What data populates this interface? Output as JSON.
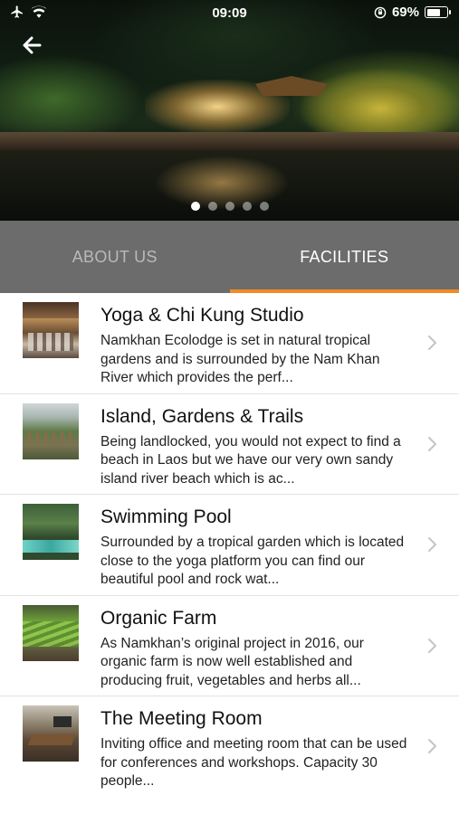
{
  "status_bar": {
    "time": "09:09",
    "battery_percent": "69%",
    "battery_level": 0.69,
    "icons": [
      "airplane-icon",
      "wifi-icon",
      "orientation-lock-icon",
      "battery-icon"
    ]
  },
  "hero": {
    "carousel_pages": 5,
    "active_page": 1
  },
  "tabs": [
    {
      "label": "ABOUT US",
      "active": false
    },
    {
      "label": "FACILITIES",
      "active": true
    }
  ],
  "accent_color": "#f08a24",
  "tab_bar_color": "#6c6c6c",
  "facilities": [
    {
      "title": "Yoga & Chi Kung Studio",
      "description": "Namkhan Ecolodge is set in natural tropical gardens and is surrounded by the Nam Khan River which provides the perf..."
    },
    {
      "title": "Island, Gardens & Trails",
      "description": "Being landlocked, you would not expect to find a beach in Laos but we have our very own sandy island river beach which is ac..."
    },
    {
      "title": "Swimming Pool",
      "description": "Surrounded by a tropical garden which is located close to the yoga platform you can find our beautiful pool and rock wat..."
    },
    {
      "title": "Organic Farm",
      "description": "As Namkhan’s original project in 2016, our organic farm is now well established and producing fruit, vegetables and herbs all..."
    },
    {
      "title": "The Meeting Room",
      "description": "Inviting office and meeting room that can be used for conferences and workshops. Capacity 30 people..."
    }
  ]
}
